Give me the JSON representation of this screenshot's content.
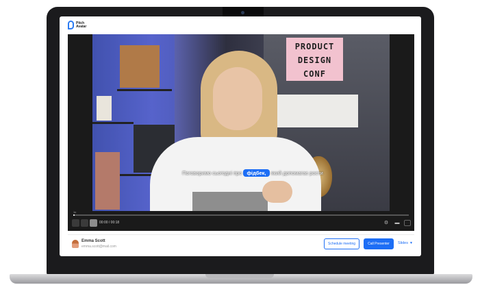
{
  "app": {
    "logo_text": "Pitch Avatar"
  },
  "video": {
    "sign_lines": [
      "PRODUCT",
      "DESIGN",
      "CONF"
    ],
    "subtitle_before": "Поговоримо сьогодні про ",
    "subtitle_highlight": "фідбек,",
    "subtitle_after": " який допомагає рости",
    "progress_fraction": 0.005
  },
  "controls": {
    "speed_label": "1x",
    "time": "00:00 / 00:18",
    "icons": [
      "rewind-icon",
      "play-icon",
      "forward-icon",
      "settings-icon",
      "captions-icon",
      "fullscreen-icon"
    ]
  },
  "footer": {
    "user_name": "Emma Scott",
    "user_email": "emma.scott@mail.com",
    "schedule_label": "Schedule meeting",
    "call_label": "Call Presenter",
    "slides_label": "Slides"
  },
  "colors": {
    "accent": "#1d6ef5",
    "player_bg": "#1a1a1a",
    "sign_bg": "#f2c2cf"
  }
}
